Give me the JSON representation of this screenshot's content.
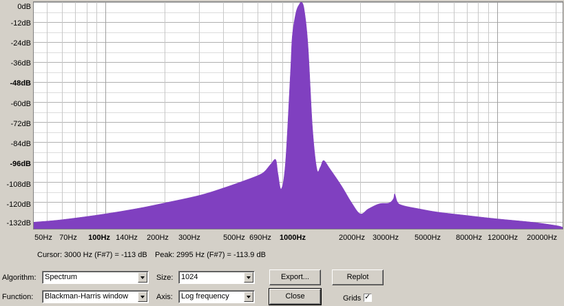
{
  "chart_data": {
    "type": "area",
    "title": "",
    "xlabel": "",
    "ylabel": "",
    "x_scale": "log",
    "xlim": [
      43,
      21600
    ],
    "ylim": [
      -136,
      0
    ],
    "y_ticks": [
      "0dB",
      "-12dB",
      "-24dB",
      "-36dB",
      "-48dB",
      "-60dB",
      "-72dB",
      "-84dB",
      "-96dB",
      "-108dB",
      "-120dB",
      "-132dB"
    ],
    "x_ticks": [
      "50Hz",
      "70Hz",
      "100Hz",
      "140Hz",
      "200Hz",
      "300Hz",
      "500Hz",
      "690Hz",
      "1000Hz",
      "2000Hz",
      "3000Hz",
      "5000Hz",
      "8000Hz",
      "12000Hz",
      "20000Hz"
    ],
    "grid": true,
    "fill_color": "#8040c0",
    "series": [
      {
        "x": [
          43,
          60,
          100,
          150,
          200,
          300,
          400,
          500,
          600,
          650,
          700,
          740,
          760,
          790,
          830,
          880,
          900,
          940,
          980,
          1000,
          1030,
          1080,
          1140,
          1200,
          1250,
          1300,
          1400,
          1600,
          1800,
          2000,
          2200,
          2500,
          2800,
          2950,
          3000,
          3100,
          3300,
          4000,
          5000,
          7000,
          10000,
          15000,
          20000,
          21600
        ],
        "y": [
          -132,
          -130.5,
          -127,
          -123.5,
          -120.5,
          -116,
          -111.5,
          -107.5,
          -104,
          -101.5,
          -97,
          -94.5,
          -103,
          -112,
          -96,
          -42,
          -20,
          -6,
          -1,
          0,
          -3,
          -25,
          -75,
          -100,
          -99,
          -95,
          -100,
          -110,
          -120,
          -127,
          -124,
          -121,
          -120.5,
          -118,
          -115,
          -120,
          -122,
          -124,
          -126,
          -128,
          -130,
          -132,
          -134,
          -135
        ]
      }
    ]
  },
  "status": {
    "cursor": "Cursor: 3000 Hz (F#7) = -113 dB",
    "peak": "Peak: 2995 Hz (F#7) = -113.9 dB"
  },
  "controls": {
    "algorithm_label": "Algorithm:",
    "algorithm_value": "Spectrum",
    "size_label": "Size:",
    "size_value": "1024",
    "function_label": "Function:",
    "function_value": "Blackman-Harris window",
    "axis_label": "Axis:",
    "axis_value": "Log frequency",
    "export_label": "Export...",
    "replot_label": "Replot",
    "close_label": "Close",
    "grids_label": "Grids",
    "grids_checked": true
  }
}
